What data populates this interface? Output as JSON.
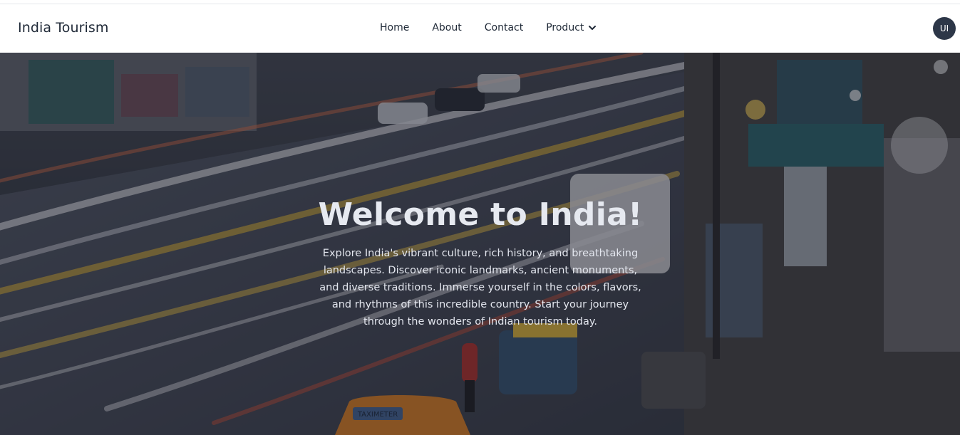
{
  "brand": {
    "name": "India Tourism"
  },
  "nav": {
    "home": "Home",
    "about": "About",
    "contact": "Contact",
    "product": "Product"
  },
  "user": {
    "initials": "UI"
  },
  "hero": {
    "title": "Welcome to India!",
    "description": "Explore India's vibrant culture, rich history, and breathtaking landscapes. Discover iconic landmarks, ancient monuments, and diverse traditions. Immerse yourself in the colors, flavors, and rhythms of this incredible country. Start your journey through the wonders of Indian tourism today.",
    "background": "busy street at night with long-exposure traffic light trails, market stalls and auto-rickshaws",
    "taxi_sign": "TAXIMETER"
  },
  "icons": {
    "dropdown": "chevron-down-icon"
  },
  "colors": {
    "navbar": "#ffffff",
    "avatar": "#2d3748",
    "overlay": "#141824"
  }
}
